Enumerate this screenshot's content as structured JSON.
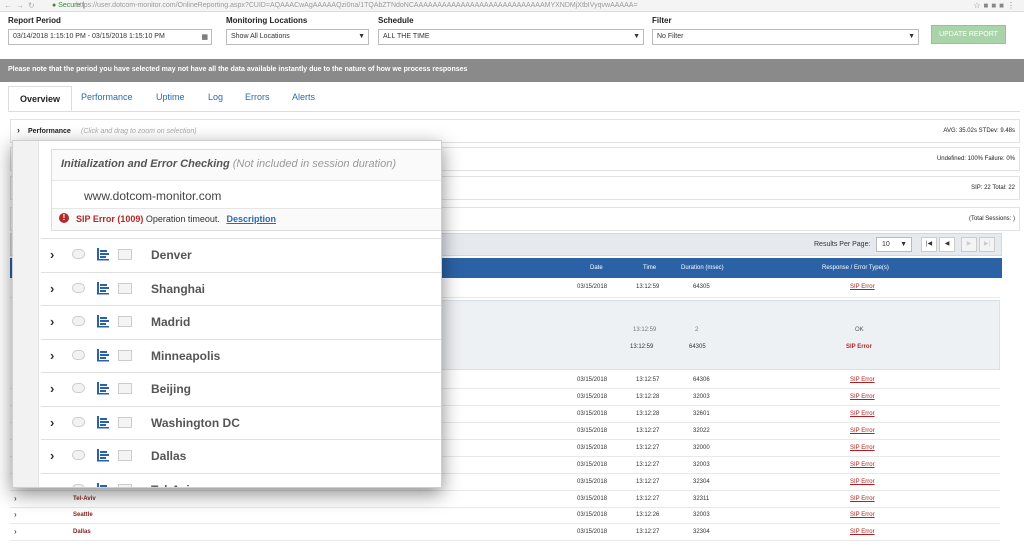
{
  "browser": {
    "secure_label": "Secure",
    "url": "https://user.dotcom-monitor.com/OnlineReporting.aspx?CUID=AQAAACwAgAAAAAQzi0na/1TQAbZTNdoNCAAAAAAAAAAAAAAAAAAAAAAAAAAAAMYXNDMjXtbIVyqvwAAAAA="
  },
  "filters": {
    "report_period_label": "Report Period",
    "report_period_value": "03/14/2018 1:15:10 PM - 03/15/2018 1:15:10 PM",
    "monitoring_locations_label": "Monitoring Locations",
    "monitoring_locations_value": "Show All Locations",
    "schedule_label": "Schedule",
    "schedule_value": "ALL THE TIME",
    "filter_label": "Filter",
    "filter_value": "No Filter",
    "update_button": "UPDATE REPORT"
  },
  "notice": "Please note that the period you have selected may not have all the data available instantly due to the nature of how we process responses",
  "tabs": [
    "Overview",
    "Performance",
    "Uptime",
    "Log",
    "Errors",
    "Alerts"
  ],
  "sections": {
    "performance_title": "Performance",
    "performance_hint": "(Click and drag to zoom on selection)",
    "performance_stats": "AVG: 35.02s  STDev: 9.48s",
    "uptime_stats": "Undefined: 100%  Failure: 0%",
    "errors_stats": "SIP: 22  Total: 22",
    "sessions_stats": "(Total Sessions: )"
  },
  "pager": {
    "results_per_page_label": "Results Per Page:",
    "results_per_page_value": "10"
  },
  "table": {
    "headers": {
      "date": "Date",
      "time": "Time",
      "duration": "Duration (msec)",
      "response": "Response / Error Type(s)"
    },
    "expanded_row": {
      "date": "03/15/2018",
      "time": "13:12:59",
      "duration": "64305",
      "response": "SIP Error"
    },
    "sub_rows": [
      {
        "time": "13:12:59",
        "duration": "2",
        "response": "OK"
      },
      {
        "time": "13:12:59",
        "duration": "64305",
        "response": "SIP Error"
      }
    ],
    "rows": [
      {
        "name": "",
        "date": "03/15/2018",
        "time": "13:12:57",
        "duration": "64306",
        "response": "SIP Error"
      },
      {
        "name": "",
        "date": "03/15/2018",
        "time": "13:12:28",
        "duration": "32003",
        "response": "SIP Error"
      },
      {
        "name": "",
        "date": "03/15/2018",
        "time": "13:12:28",
        "duration": "32601",
        "response": "SIP Error"
      },
      {
        "name": "",
        "date": "03/15/2018",
        "time": "13:12:27",
        "duration": "32022",
        "response": "SIP Error"
      },
      {
        "name": "",
        "date": "03/15/2018",
        "time": "13:12:27",
        "duration": "32000",
        "response": "SIP Error"
      },
      {
        "name": "",
        "date": "03/15/2018",
        "time": "13:12:27",
        "duration": "32003",
        "response": "SIP Error"
      },
      {
        "name": "Dallas",
        "date": "03/15/2018",
        "time": "13:12:27",
        "duration": "32304",
        "response": "SIP Error"
      },
      {
        "name": "Tel-Aviv",
        "date": "03/15/2018",
        "time": "13:12:27",
        "duration": "32311",
        "response": "SIP Error"
      },
      {
        "name": "Seattle",
        "date": "03/15/2018",
        "time": "13:12:26",
        "duration": "32003",
        "response": "SIP Error"
      },
      {
        "name": "Dallas",
        "date": "03/15/2018",
        "time": "13:12:27",
        "duration": "32304",
        "response": "SIP Error"
      }
    ]
  },
  "popup": {
    "title": "Initialization and Error Checking",
    "title_note": "(Not included in session duration)",
    "domain": "www.dotcom-monitor.com",
    "error_code": "SIP Error (1009)",
    "error_message": "Operation timeout.",
    "description_link": "Description",
    "locations": [
      "Denver",
      "Shanghai",
      "Madrid",
      "Minneapolis",
      "Beijing",
      "Washington DC",
      "Dallas",
      "Tel-Aviv"
    ]
  },
  "colors": {
    "table_header": "#2b62a6",
    "error_red": "#b22a2a",
    "link_blue": "#2a6ab0",
    "notice_bg": "#8a8a8a",
    "update_button": "#a9d4a9"
  },
  "icons": [
    "chevron-right-icon",
    "chat-bubble-icon",
    "bar-chart-icon",
    "document-icon",
    "error-icon",
    "calendar-icon",
    "dropdown-arrow-icon",
    "lock-icon"
  ]
}
